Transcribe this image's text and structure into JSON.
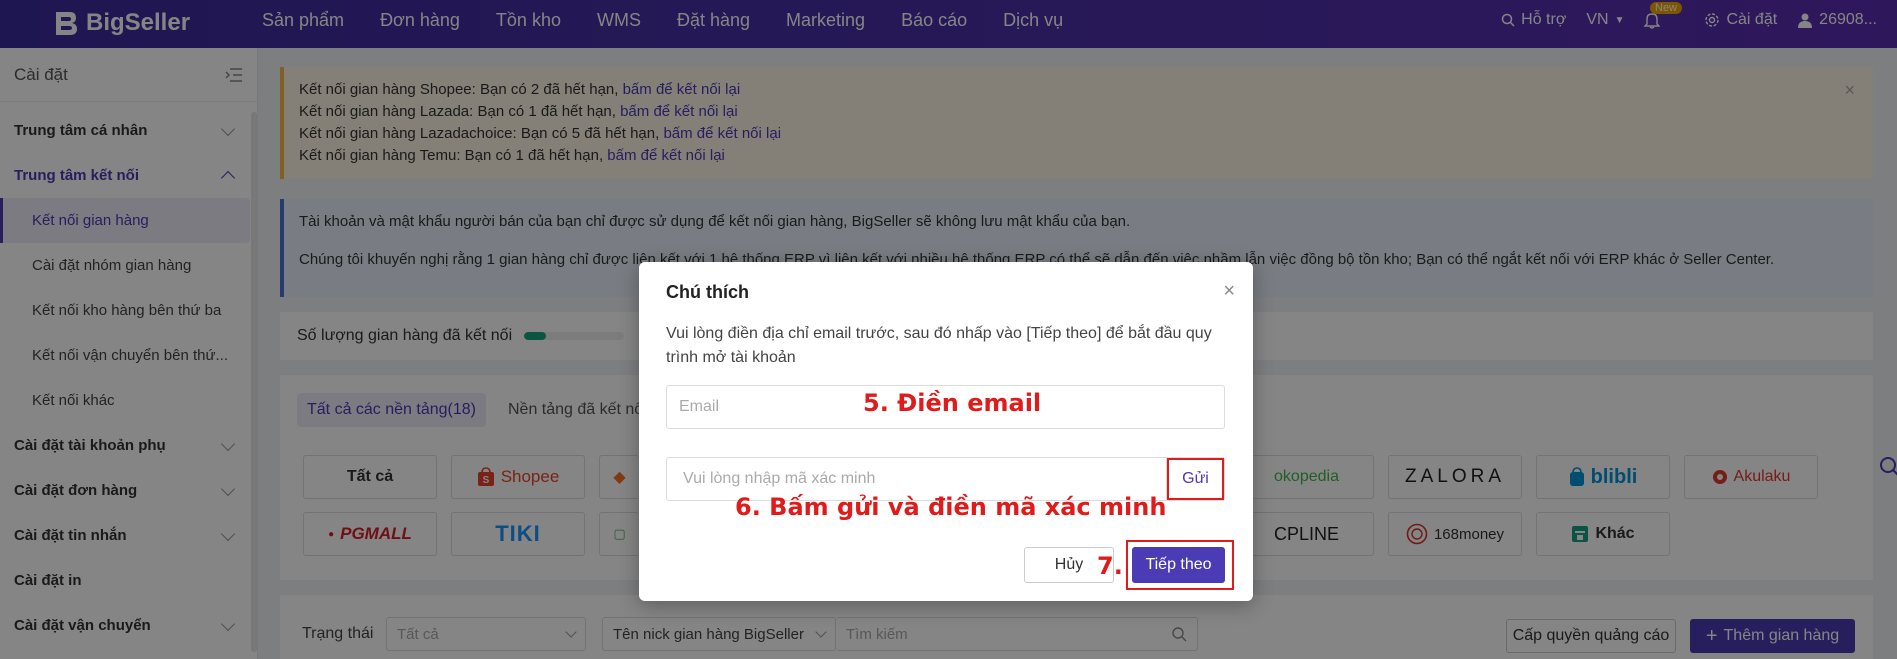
{
  "brand": {
    "name": "BigSeller"
  },
  "topnav": {
    "items": [
      "Sản phẩm",
      "Đơn hàng",
      "Tồn kho",
      "WMS",
      "Đặt hàng",
      "Marketing",
      "Báo cáo",
      "Dịch vụ"
    ],
    "support": "Hỗ trợ",
    "language": "VN",
    "new_badge": "New",
    "settings": "Cài đặt",
    "user": "26908..."
  },
  "sidebar": {
    "title": "Cài đặt",
    "groups": [
      {
        "label": "Trung tâm cá nhân"
      },
      {
        "label": "Trung tâm kết nối",
        "expanded": true,
        "items": [
          "Kết nối gian hàng",
          "Cài đặt nhóm gian hàng",
          "Kết nối kho hàng bên thứ ba",
          "Kết nối vận chuyển bên thứ...",
          "Kết nối khác"
        ]
      },
      {
        "label": "Cài đặt tài khoản phụ"
      },
      {
        "label": "Cài đặt đơn hàng"
      },
      {
        "label": "Cài đặt tin nhắn"
      },
      {
        "label": "Cài đặt in"
      },
      {
        "label": "Cài đặt vận chuyển"
      }
    ]
  },
  "alerts": {
    "expired": [
      {
        "text": "Kết nối gian hàng Shopee: Bạn có 2 đã hết hạn, ",
        "link": "bấm để kết nối lại"
      },
      {
        "text": "Kết nối gian hàng Lazada: Bạn có 1 đã hết hạn, ",
        "link": "bấm để kết nối lại"
      },
      {
        "text": "Kết nối gian hàng Lazadachoice: Bạn có 5 đã hết hạn, ",
        "link": "bấm để kết nối lại"
      },
      {
        "text": "Kết nối gian hàng Temu: Bạn có 1 đã hết hạn, ",
        "link": "bấm để kết nối lại"
      }
    ],
    "info_1": "Tài khoản và mật khẩu người bán của bạn chỉ được sử dụng để kết nối gian hàng, BigSeller sẽ không lưu mật khẩu của bạn.",
    "info_2": "Chúng tôi khuyến nghị rằng 1 gian hàng chỉ được liên kết với 1 hệ thống ERP vì liên kết với nhiều hệ thống ERP có thể sẽ dẫn đến việc nhầm lẫn việc đồng bộ tồn kho; Bạn có thể ngắt kết nối với ERP khác ở Seller Center."
  },
  "connected_count": {
    "label": "Số lượng gian hàng đã kết nối"
  },
  "platform_tabs": [
    "Tất cả các nền tảng(18)",
    "Nền tảng đã kết nối"
  ],
  "platforms": {
    "all": "Tất cả",
    "shopee": "Shopee",
    "tokopedia": "okopedia",
    "zalora": "ZALORA",
    "blibli": "blibli",
    "akulaku": "Akulaku",
    "pgmall": "PGMALL",
    "tiki": "TIKI",
    "qoo10": "CPLINE",
    "money168": "168money",
    "khac": "Khác"
  },
  "filters": {
    "status_label": "Trạng thái",
    "status_value": "Tất cả",
    "nick_select": "Tên nick gian hàng BigSeller",
    "search_placeholder": "Tìm kiếm",
    "ads_button": "Cấp quyền quảng cáo",
    "add_button": "Thêm gian hàng"
  },
  "modal": {
    "title": "Chú thích",
    "description": "Vui lòng điền địa chỉ email trước, sau đó nhấp vào [Tiếp theo] để bắt đầu quy trình mở tài khoản",
    "email_placeholder": "Email",
    "code_placeholder": "Vui lòng nhập mã xác minh",
    "send_label": "Gửi",
    "cancel_label": "Hủy",
    "next_label": "Tiếp theo"
  },
  "annotations": {
    "step5": "5.  Điền email",
    "step6": "6. Bấm gửi và điền mã xác minh",
    "step7": "7."
  },
  "colors": {
    "primary": "#4b3bb5",
    "nav_bg": "#4a2fa8",
    "annotation_red": "#e01b1b",
    "alert_yellow": "#fdf6e6",
    "alert_blue": "#e8f0fb"
  }
}
